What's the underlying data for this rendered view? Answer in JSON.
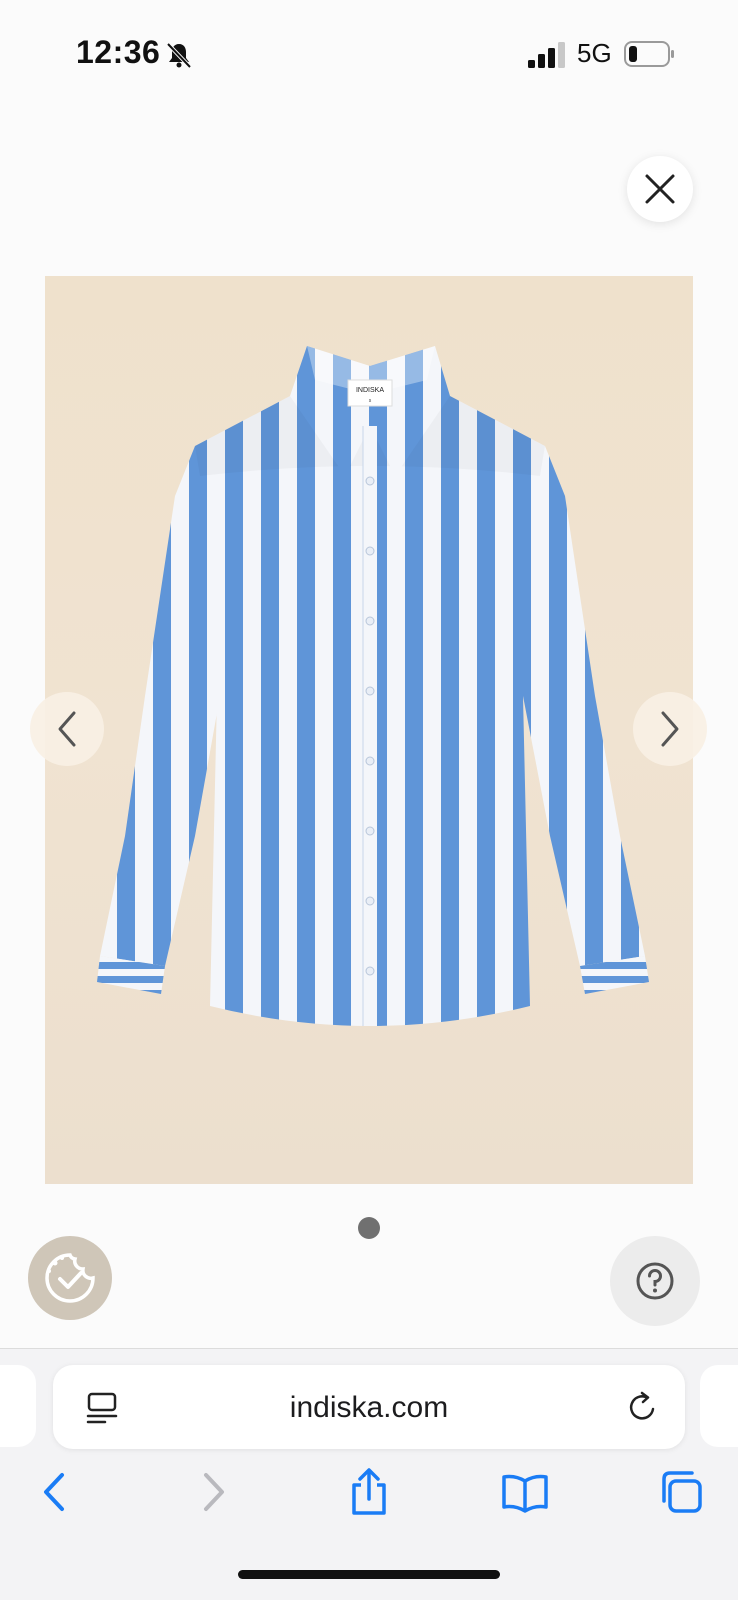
{
  "status_bar": {
    "time": "12:36",
    "network": "5G",
    "icons": [
      "bell-slash-icon",
      "signal-icon",
      "battery-icon"
    ]
  },
  "product": {
    "image_label": "INDISKA",
    "image_description": "blue-white-striped-shirt",
    "carousel_page": 1,
    "carousel_total": 1
  },
  "overlay": {
    "close_icon": "close-icon",
    "prev_icon": "chevron-left-icon",
    "next_icon": "chevron-right-icon",
    "cookie_icon": "cookie-consent-icon",
    "help_icon": "question-icon"
  },
  "browser": {
    "url": "indiska.com",
    "toolbar": [
      "back-icon",
      "forward-icon",
      "share-icon",
      "bookmarks-icon",
      "tabs-icon"
    ]
  },
  "colors": {
    "accent": "#1a7cf5",
    "stripe_blue": "#5f95d8",
    "backdrop": "#efe1cc"
  }
}
